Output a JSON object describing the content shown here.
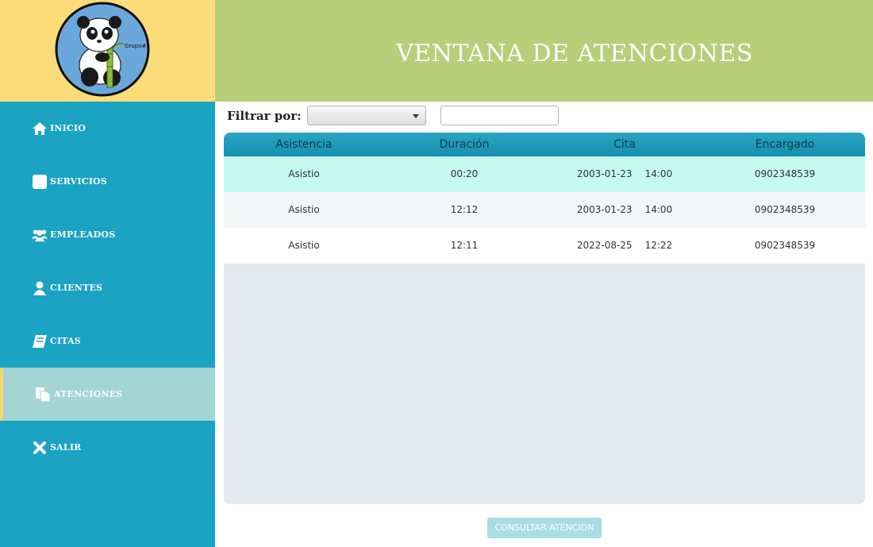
{
  "logo": {
    "text": "Grupo#1"
  },
  "header": {
    "title": "VENTANA DE ATENCIONES"
  },
  "sidebar": {
    "items": [
      {
        "label": "INICIO",
        "icon": "home-icon"
      },
      {
        "label": "SERVICIOS",
        "icon": "square-icon"
      },
      {
        "label": "EMPLEADOS",
        "icon": "users-icon"
      },
      {
        "label": "CLIENTES",
        "icon": "user-icon"
      },
      {
        "label": "CITAS",
        "icon": "book-icon"
      },
      {
        "label": "ATENCIONES",
        "icon": "files-icon",
        "active": true
      },
      {
        "label": "SALIR",
        "icon": "close-icon"
      }
    ]
  },
  "filter": {
    "label": "Filtrar por:",
    "select_value": "",
    "input_value": ""
  },
  "table": {
    "columns": [
      "Asistencia",
      "Duración",
      "Cita",
      "Encargado"
    ],
    "rows": [
      {
        "asistencia": "Asistio",
        "duracion": "00:20",
        "cita_fecha": "2003-01-23",
        "cita_hora": "14:00",
        "encargado": "0902348539"
      },
      {
        "asistencia": "Asistio",
        "duracion": "12:12",
        "cita_fecha": "2003-01-23",
        "cita_hora": "14:00",
        "encargado": "0902348539"
      },
      {
        "asistencia": "Asistio",
        "duracion": "12:11",
        "cita_fecha": "2022-08-25",
        "cita_hora": "12:22",
        "encargado": "0902348539"
      }
    ]
  },
  "button": {
    "consult_label": "CONSULTAR ATENCION"
  },
  "colors": {
    "sidebar": "#1aa3c3",
    "header": "#b8ce79",
    "logo_bg": "#fcdb79",
    "active_item": "#a2d5d4",
    "selected_row": "#c6faf1"
  }
}
